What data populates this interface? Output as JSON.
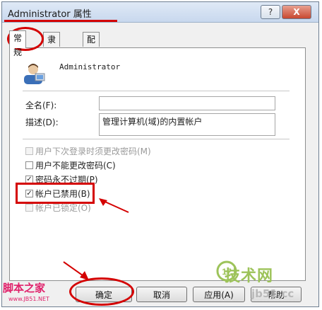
{
  "window": {
    "title": "Administrator 属性",
    "help_label": "?",
    "close_label": "X"
  },
  "tabs": [
    {
      "label": "常规"
    },
    {
      "label": "隶属于"
    },
    {
      "label": "配置文件"
    }
  ],
  "general": {
    "username": "Administrator",
    "fullname_label": "全名(F):",
    "fullname_value": "",
    "description_label": "描述(D):",
    "description_value": "管理计算机(域)的内置帐户",
    "checkboxes": [
      {
        "label": "用户下次登录时须更改密码(M)",
        "checked": false,
        "enabled": false
      },
      {
        "label": "用户不能更改密码(C)",
        "checked": false,
        "enabled": true
      },
      {
        "label": "密码永不过期(P)",
        "checked": true,
        "enabled": true
      },
      {
        "label": "帐户已禁用(B)",
        "checked": true,
        "enabled": true
      },
      {
        "label": "帐户已锁定(O)",
        "checked": false,
        "enabled": false
      }
    ]
  },
  "buttons": {
    "ok": "确定",
    "cancel": "取消",
    "apply": "应用(A)",
    "help": "帮助"
  },
  "watermarks": {
    "left": "脚本之家",
    "left_sub": "www.JB51.NET",
    "right": "技术网",
    "right_sub": "jb51.cc",
    "right_logo": "17"
  },
  "colors": {
    "annotation": "#d40000",
    "watermark_left": "#e0206a",
    "watermark_right": "#9dc35a"
  }
}
